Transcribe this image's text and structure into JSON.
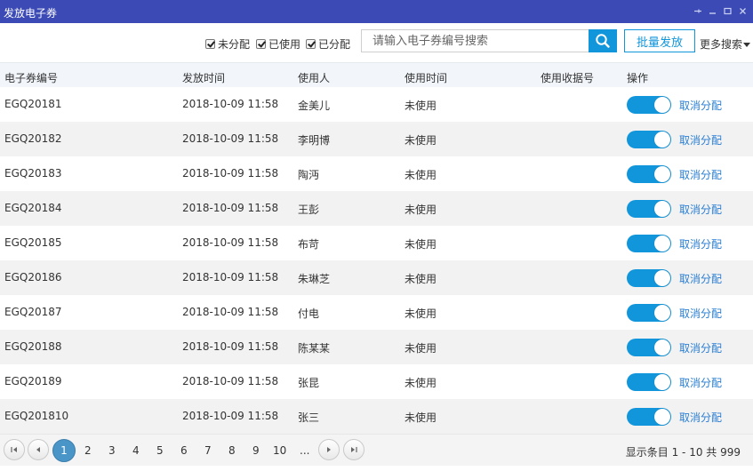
{
  "window": {
    "title": "发放电子券",
    "controls": [
      "pin-icon",
      "minimize-icon",
      "maximize-icon",
      "close-icon"
    ]
  },
  "toolbar": {
    "filters": [
      {
        "label": "未分配",
        "checked": true
      },
      {
        "label": "已使用",
        "checked": true
      },
      {
        "label": "已分配",
        "checked": true
      }
    ],
    "search_placeholder": "请输入电子券编号搜索",
    "batch_label": "批量发放",
    "more_search_label": "更多搜索"
  },
  "table": {
    "columns": [
      "电子券编号",
      "发放时间",
      "使用人",
      "使用时间",
      "使用收据号",
      "操作"
    ],
    "rows": [
      {
        "id": "EGQ20181",
        "time": "2018-10-09 11:58",
        "user": "金美儿",
        "used_time": "未使用",
        "receipt": "",
        "action": "取消分配",
        "toggle_on": true
      },
      {
        "id": "EGQ20182",
        "time": "2018-10-09 11:58",
        "user": "李明博",
        "used_time": "未使用",
        "receipt": "",
        "action": "取消分配",
        "toggle_on": true
      },
      {
        "id": "EGQ20183",
        "time": "2018-10-09 11:58",
        "user": "陶沔",
        "used_time": "未使用",
        "receipt": "",
        "action": "取消分配",
        "toggle_on": true
      },
      {
        "id": "EGQ20184",
        "time": "2018-10-09 11:58",
        "user": "王彭",
        "used_time": "未使用",
        "receipt": "",
        "action": "取消分配",
        "toggle_on": true
      },
      {
        "id": "EGQ20185",
        "time": "2018-10-09 11:58",
        "user": "布苛",
        "used_time": "未使用",
        "receipt": "",
        "action": "取消分配",
        "toggle_on": true
      },
      {
        "id": "EGQ20186",
        "time": "2018-10-09 11:58",
        "user": "朱琳芝",
        "used_time": "未使用",
        "receipt": "",
        "action": "取消分配",
        "toggle_on": true
      },
      {
        "id": "EGQ20187",
        "time": "2018-10-09 11:58",
        "user": "付电",
        "used_time": "未使用",
        "receipt": "",
        "action": "取消分配",
        "toggle_on": true
      },
      {
        "id": "EGQ20188",
        "time": "2018-10-09 11:58",
        "user": "陈某某",
        "used_time": "未使用",
        "receipt": "",
        "action": "取消分配",
        "toggle_on": true
      },
      {
        "id": "EGQ20189",
        "time": "2018-10-09 11:58",
        "user": "张昆",
        "used_time": "未使用",
        "receipt": "",
        "action": "取消分配",
        "toggle_on": true
      },
      {
        "id": "EGQ201810",
        "time": "2018-10-09 11:58",
        "user": "张三",
        "used_time": "未使用",
        "receipt": "",
        "action": "取消分配",
        "toggle_on": true
      }
    ]
  },
  "pager": {
    "pages": [
      "1",
      "2",
      "3",
      "4",
      "5",
      "6",
      "7",
      "8",
      "9",
      "10",
      "..."
    ],
    "current": "1",
    "info": "显示条目 1 - 10 共 999"
  },
  "colors": {
    "titlebar": "#3b4ab5",
    "accent": "#1296db",
    "link": "#2a7fd4",
    "active_page": "#4a95c8"
  }
}
